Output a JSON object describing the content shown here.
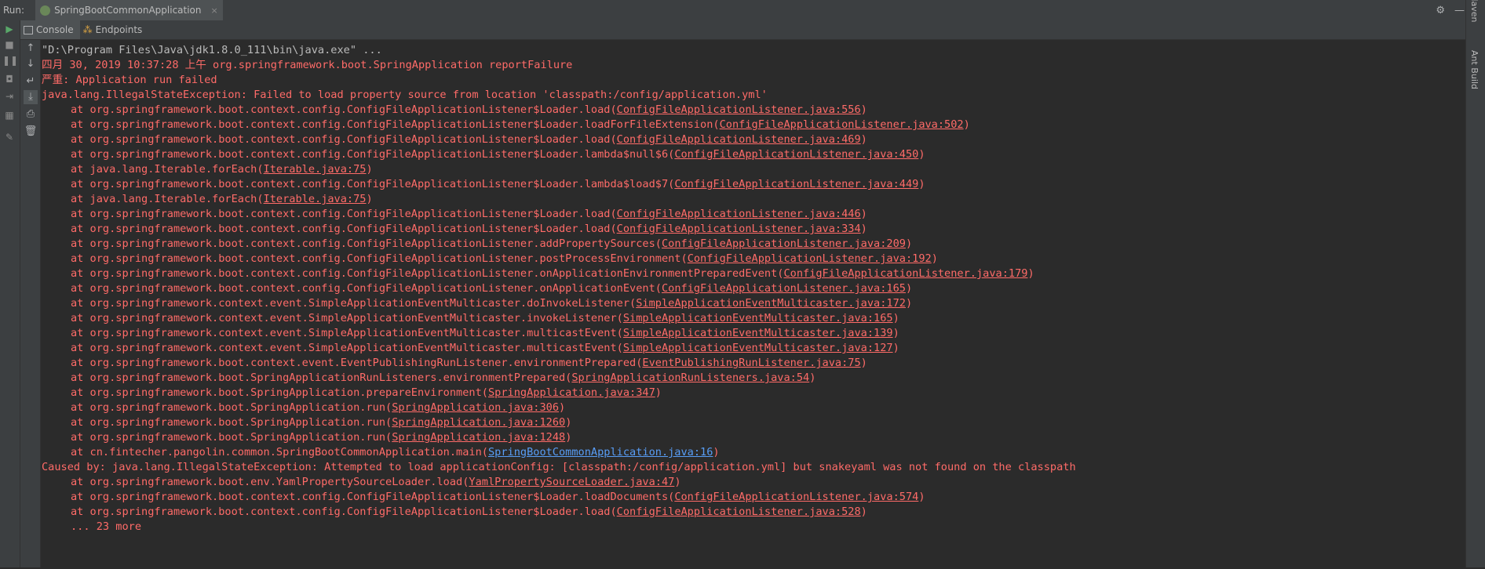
{
  "run_bar": {
    "label": "Run:",
    "config_tab": "SpringBootCommonApplication",
    "close_glyph": "×",
    "settings_glyph": "⚙",
    "minimize_glyph": "—"
  },
  "subtabs": [
    {
      "label": "Console",
      "icon": "console-icon",
      "active": true
    },
    {
      "label": "Endpoints",
      "icon": "endpoints-icon",
      "active": false
    }
  ],
  "right_tool": {
    "maven": "Maven",
    "ant": "Ant Build"
  },
  "console": {
    "cmd": "\"D:\\Program Files\\Java\\jdk1.8.0_111\\bin\\java.exe\" ...",
    "log_line": "四月 30, 2019 10:37:28 上午 org.springframework.boot.SpringApplication reportFailure",
    "severe_line": "严重: Application run failed",
    "exception": "java.lang.IllegalStateException: Failed to load property source from location 'classpath:/config/application.yml'",
    "frames": [
      {
        "text": "at org.springframework.boot.context.config.ConfigFileApplicationListener$Loader.load(",
        "link": "ConfigFileApplicationListener.java:556",
        "end": ")"
      },
      {
        "text": "at org.springframework.boot.context.config.ConfigFileApplicationListener$Loader.loadForFileExtension(",
        "link": "ConfigFileApplicationListener.java:502",
        "end": ")"
      },
      {
        "text": "at org.springframework.boot.context.config.ConfigFileApplicationListener$Loader.load(",
        "link": "ConfigFileApplicationListener.java:469",
        "end": ")"
      },
      {
        "text": "at org.springframework.boot.context.config.ConfigFileApplicationListener$Loader.lambda$null$6(",
        "link": "ConfigFileApplicationListener.java:450",
        "end": ")"
      },
      {
        "text": "at java.lang.Iterable.forEach(",
        "link": "Iterable.java:75",
        "end": ")"
      },
      {
        "text": "at org.springframework.boot.context.config.ConfigFileApplicationListener$Loader.lambda$load$7(",
        "link": "ConfigFileApplicationListener.java:449",
        "end": ")"
      },
      {
        "text": "at java.lang.Iterable.forEach(",
        "link": "Iterable.java:75",
        "end": ")"
      },
      {
        "text": "at org.springframework.boot.context.config.ConfigFileApplicationListener$Loader.load(",
        "link": "ConfigFileApplicationListener.java:446",
        "end": ")"
      },
      {
        "text": "at org.springframework.boot.context.config.ConfigFileApplicationListener$Loader.load(",
        "link": "ConfigFileApplicationListener.java:334",
        "end": ")"
      },
      {
        "text": "at org.springframework.boot.context.config.ConfigFileApplicationListener.addPropertySources(",
        "link": "ConfigFileApplicationListener.java:209",
        "end": ")"
      },
      {
        "text": "at org.springframework.boot.context.config.ConfigFileApplicationListener.postProcessEnvironment(",
        "link": "ConfigFileApplicationListener.java:192",
        "end": ")"
      },
      {
        "text": "at org.springframework.boot.context.config.ConfigFileApplicationListener.onApplicationEnvironmentPreparedEvent(",
        "link": "ConfigFileApplicationListener.java:179",
        "end": ")"
      },
      {
        "text": "at org.springframework.boot.context.config.ConfigFileApplicationListener.onApplicationEvent(",
        "link": "ConfigFileApplicationListener.java:165",
        "end": ")"
      },
      {
        "text": "at org.springframework.context.event.SimpleApplicationEventMulticaster.doInvokeListener(",
        "link": "SimpleApplicationEventMulticaster.java:172",
        "end": ")"
      },
      {
        "text": "at org.springframework.context.event.SimpleApplicationEventMulticaster.invokeListener(",
        "link": "SimpleApplicationEventMulticaster.java:165",
        "end": ")"
      },
      {
        "text": "at org.springframework.context.event.SimpleApplicationEventMulticaster.multicastEvent(",
        "link": "SimpleApplicationEventMulticaster.java:139",
        "end": ")"
      },
      {
        "text": "at org.springframework.context.event.SimpleApplicationEventMulticaster.multicastEvent(",
        "link": "SimpleApplicationEventMulticaster.java:127",
        "end": ")"
      },
      {
        "text": "at org.springframework.boot.context.event.EventPublishingRunListener.environmentPrepared(",
        "link": "EventPublishingRunListener.java:75",
        "end": ")"
      },
      {
        "text": "at org.springframework.boot.SpringApplicationRunListeners.environmentPrepared(",
        "link": "SpringApplicationRunListeners.java:54",
        "end": ")"
      },
      {
        "text": "at org.springframework.boot.SpringApplication.prepareEnvironment(",
        "link": "SpringApplication.java:347",
        "end": ")"
      },
      {
        "text": "at org.springframework.boot.SpringApplication.run(",
        "link": "SpringApplication.java:306",
        "end": ")"
      },
      {
        "text": "at org.springframework.boot.SpringApplication.run(",
        "link": "SpringApplication.java:1260",
        "end": ")"
      },
      {
        "text": "at org.springframework.boot.SpringApplication.run(",
        "link": "SpringApplication.java:1248",
        "end": ")"
      },
      {
        "text": "at cn.fintecher.pangolin.common.SpringBootCommonApplication.main(",
        "link": "SpringBootCommonApplication.java:16",
        "end": ")",
        "blue": true
      }
    ],
    "caused_by": "Caused by: java.lang.IllegalStateException: Attempted to load applicationConfig: [classpath:/config/application.yml] but snakeyaml was not found on the classpath",
    "cause_frames": [
      {
        "text": "at org.springframework.boot.env.YamlPropertySourceLoader.load(",
        "link": "YamlPropertySourceLoader.java:47",
        "end": ")"
      },
      {
        "text": "at org.springframework.boot.context.config.ConfigFileApplicationListener$Loader.loadDocuments(",
        "link": "ConfigFileApplicationListener.java:574",
        "end": ")"
      },
      {
        "text": "at org.springframework.boot.context.config.ConfigFileApplicationListener$Loader.load(",
        "link": "ConfigFileApplicationListener.java:528",
        "end": ")"
      }
    ],
    "more": "... 23 more"
  }
}
